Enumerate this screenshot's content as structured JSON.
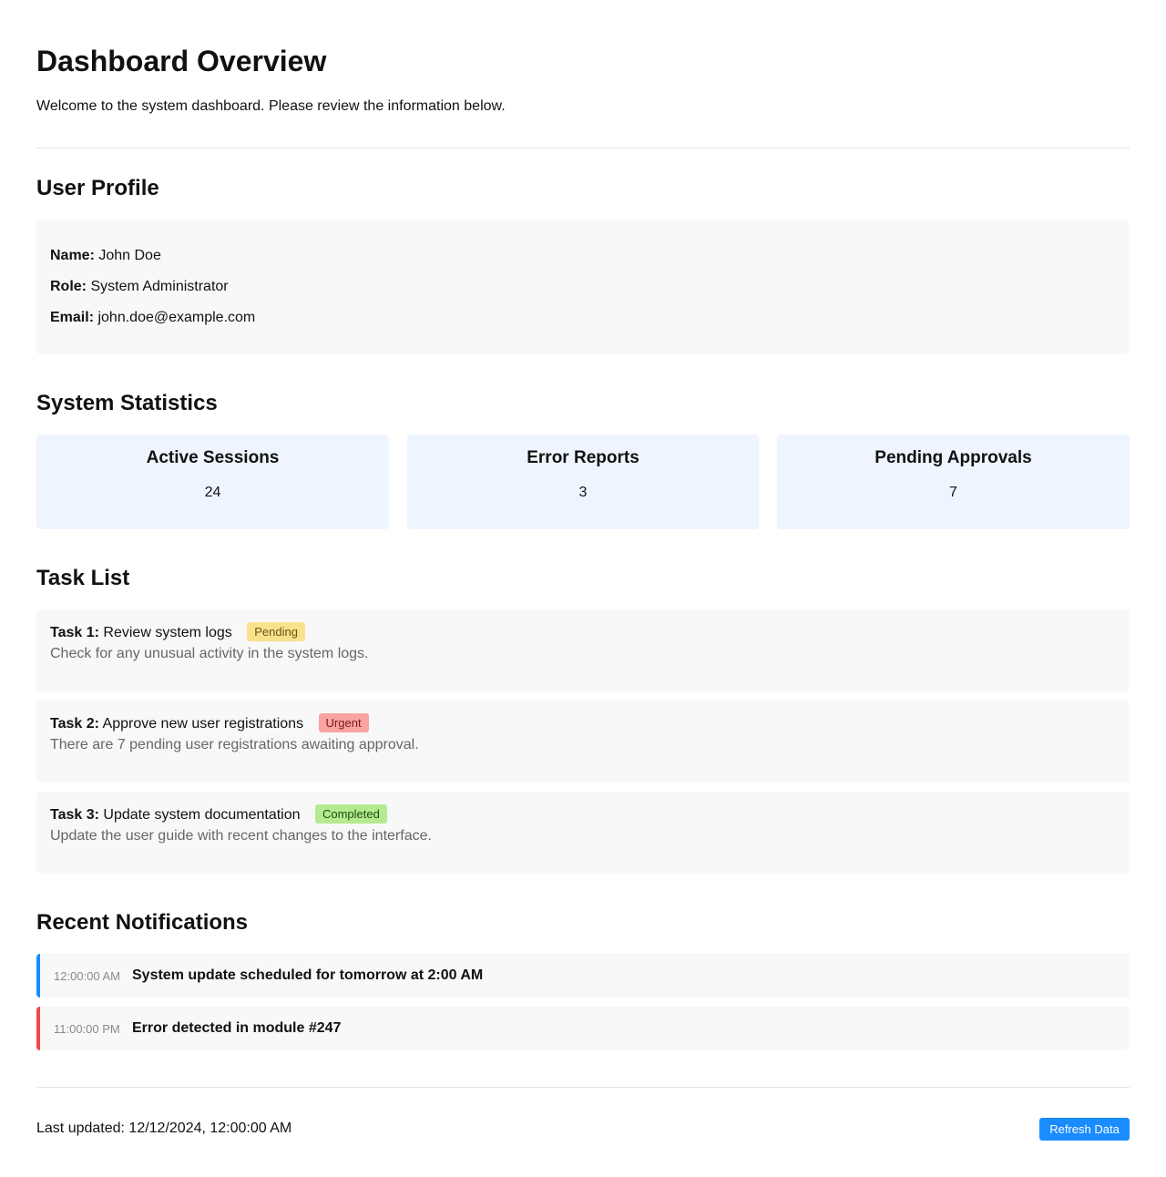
{
  "header": {
    "title": "Dashboard Overview",
    "intro": "Welcome to the system dashboard. Please review the information below."
  },
  "profile": {
    "section_title": "User Profile",
    "name_label": "Name:",
    "name": "John Doe",
    "role_label": "Role:",
    "role": "System Administrator",
    "email_label": "Email:",
    "email": "john.doe@example.com"
  },
  "stats": {
    "section_title": "System Statistics",
    "items": [
      {
        "title": "Active Sessions",
        "value": "24"
      },
      {
        "title": "Error Reports",
        "value": "3"
      },
      {
        "title": "Pending Approvals",
        "value": "7"
      }
    ]
  },
  "tasks": {
    "section_title": "Task List",
    "items": [
      {
        "label": "Task 1:",
        "title": "Review system logs",
        "status": "Pending",
        "description": "Check for any unusual activity in the system logs."
      },
      {
        "label": "Task 2:",
        "title": "Approve new user registrations",
        "status": "Urgent",
        "description": "There are 7 pending user registrations awaiting approval."
      },
      {
        "label": "Task 3:",
        "title": "Update system documentation",
        "status": "Completed",
        "description": "Update the user guide with recent changes to the interface."
      }
    ]
  },
  "notifications": {
    "section_title": "Recent Notifications",
    "items": [
      {
        "time": "12:00:00 AM",
        "text": "System update scheduled for tomorrow at 2:00 AM",
        "color": "#1a8cff"
      },
      {
        "time": "11:00:00 PM",
        "text": "Error detected in module #247",
        "color": "#f04848"
      }
    ]
  },
  "footer": {
    "last_updated": "Last updated: 12/12/2024, 12:00:00 AM",
    "refresh_label": "Refresh Data"
  },
  "colors": {
    "accent": "#1a8cff",
    "error": "#f04848",
    "pending": "#fae28c",
    "urgent": "#f9a3a3",
    "completed": "#b4eb91"
  }
}
